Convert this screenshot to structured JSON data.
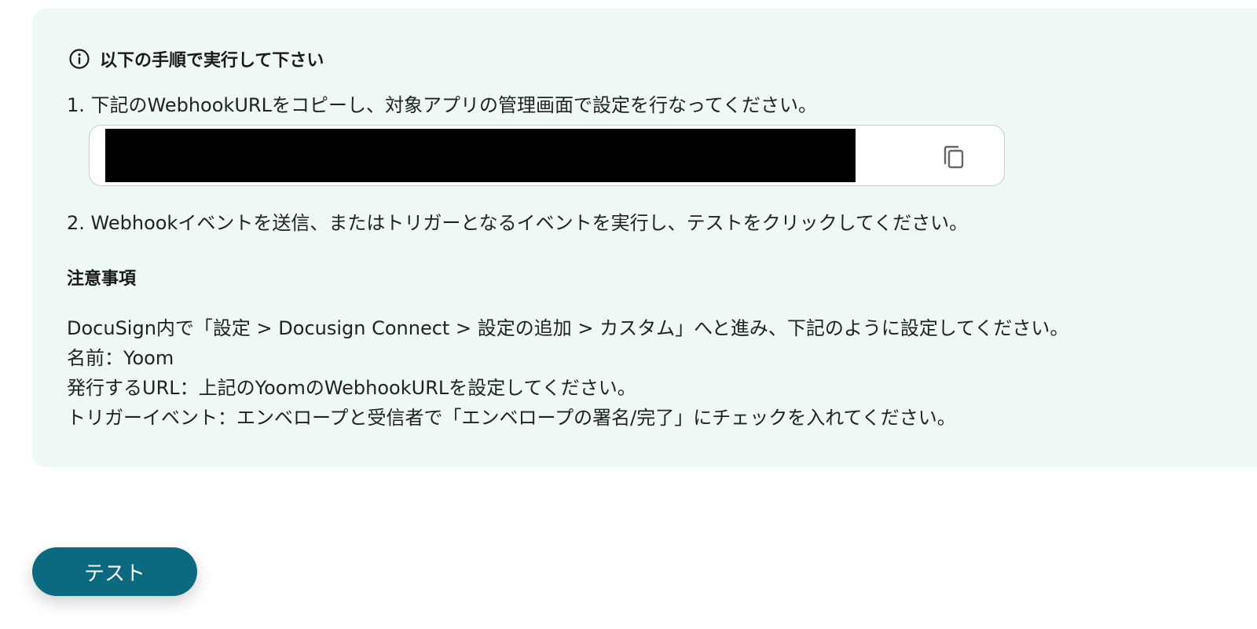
{
  "instructions": {
    "heading": "以下の手順で実行して下さい",
    "icon": "info-circle-icon",
    "step1": "1. 下記のWebhookURLをコピーし、対象アプリの管理画面で設定を行なってください。",
    "step2": "2. Webhookイベントを送信、またはトリガーとなるイベントを実行し、テストをクリックしてください。",
    "webhook_url": {
      "value": "",
      "redacted": true,
      "copy_icon": "copy-icon"
    }
  },
  "notes": {
    "title": "注意事項",
    "lines": [
      "DocuSign内で「設定 > Docusign Connect > 設定の追加 > カスタム」へと進み、下記のように設定してください。",
      "名前：Yoom",
      "発行するURL：上記のYoomのWebhookURLを設定してください。",
      "トリガーイベント：エンベロープと受信者で「エンベロープの署名/完了」にチェックを入れてください。"
    ]
  },
  "actions": {
    "test_label": "テスト"
  },
  "colors": {
    "panel_background": "#eef8f7",
    "button_background": "#0c6a80",
    "button_text": "#ffffff",
    "redaction": "#000000"
  }
}
